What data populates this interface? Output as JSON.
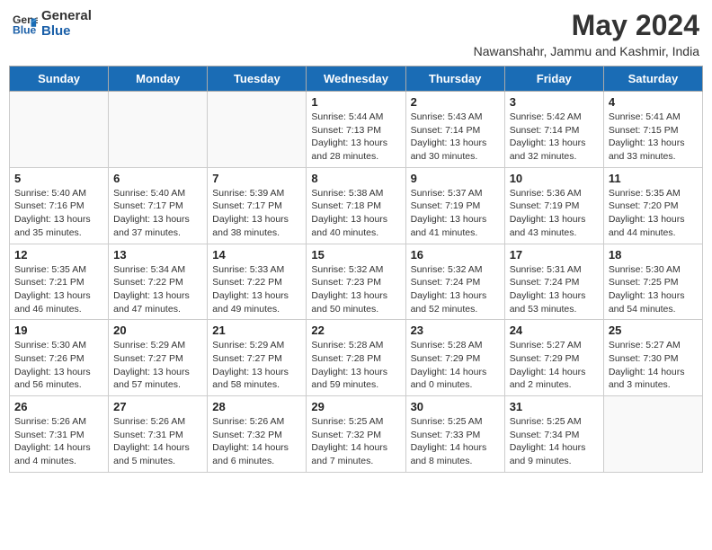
{
  "logo": {
    "general": "General",
    "blue": "Blue"
  },
  "title": "May 2024",
  "subtitle": "Nawanshahr, Jammu and Kashmir, India",
  "days_of_week": [
    "Sunday",
    "Monday",
    "Tuesday",
    "Wednesday",
    "Thursday",
    "Friday",
    "Saturday"
  ],
  "weeks": [
    [
      {
        "day": "",
        "info": ""
      },
      {
        "day": "",
        "info": ""
      },
      {
        "day": "",
        "info": ""
      },
      {
        "day": "1",
        "info": "Sunrise: 5:44 AM\nSunset: 7:13 PM\nDaylight: 13 hours\nand 28 minutes."
      },
      {
        "day": "2",
        "info": "Sunrise: 5:43 AM\nSunset: 7:14 PM\nDaylight: 13 hours\nand 30 minutes."
      },
      {
        "day": "3",
        "info": "Sunrise: 5:42 AM\nSunset: 7:14 PM\nDaylight: 13 hours\nand 32 minutes."
      },
      {
        "day": "4",
        "info": "Sunrise: 5:41 AM\nSunset: 7:15 PM\nDaylight: 13 hours\nand 33 minutes."
      }
    ],
    [
      {
        "day": "5",
        "info": "Sunrise: 5:40 AM\nSunset: 7:16 PM\nDaylight: 13 hours\nand 35 minutes."
      },
      {
        "day": "6",
        "info": "Sunrise: 5:40 AM\nSunset: 7:17 PM\nDaylight: 13 hours\nand 37 minutes."
      },
      {
        "day": "7",
        "info": "Sunrise: 5:39 AM\nSunset: 7:17 PM\nDaylight: 13 hours\nand 38 minutes."
      },
      {
        "day": "8",
        "info": "Sunrise: 5:38 AM\nSunset: 7:18 PM\nDaylight: 13 hours\nand 40 minutes."
      },
      {
        "day": "9",
        "info": "Sunrise: 5:37 AM\nSunset: 7:19 PM\nDaylight: 13 hours\nand 41 minutes."
      },
      {
        "day": "10",
        "info": "Sunrise: 5:36 AM\nSunset: 7:19 PM\nDaylight: 13 hours\nand 43 minutes."
      },
      {
        "day": "11",
        "info": "Sunrise: 5:35 AM\nSunset: 7:20 PM\nDaylight: 13 hours\nand 44 minutes."
      }
    ],
    [
      {
        "day": "12",
        "info": "Sunrise: 5:35 AM\nSunset: 7:21 PM\nDaylight: 13 hours\nand 46 minutes."
      },
      {
        "day": "13",
        "info": "Sunrise: 5:34 AM\nSunset: 7:22 PM\nDaylight: 13 hours\nand 47 minutes."
      },
      {
        "day": "14",
        "info": "Sunrise: 5:33 AM\nSunset: 7:22 PM\nDaylight: 13 hours\nand 49 minutes."
      },
      {
        "day": "15",
        "info": "Sunrise: 5:32 AM\nSunset: 7:23 PM\nDaylight: 13 hours\nand 50 minutes."
      },
      {
        "day": "16",
        "info": "Sunrise: 5:32 AM\nSunset: 7:24 PM\nDaylight: 13 hours\nand 52 minutes."
      },
      {
        "day": "17",
        "info": "Sunrise: 5:31 AM\nSunset: 7:24 PM\nDaylight: 13 hours\nand 53 minutes."
      },
      {
        "day": "18",
        "info": "Sunrise: 5:30 AM\nSunset: 7:25 PM\nDaylight: 13 hours\nand 54 minutes."
      }
    ],
    [
      {
        "day": "19",
        "info": "Sunrise: 5:30 AM\nSunset: 7:26 PM\nDaylight: 13 hours\nand 56 minutes."
      },
      {
        "day": "20",
        "info": "Sunrise: 5:29 AM\nSunset: 7:27 PM\nDaylight: 13 hours\nand 57 minutes."
      },
      {
        "day": "21",
        "info": "Sunrise: 5:29 AM\nSunset: 7:27 PM\nDaylight: 13 hours\nand 58 minutes."
      },
      {
        "day": "22",
        "info": "Sunrise: 5:28 AM\nSunset: 7:28 PM\nDaylight: 13 hours\nand 59 minutes."
      },
      {
        "day": "23",
        "info": "Sunrise: 5:28 AM\nSunset: 7:29 PM\nDaylight: 14 hours\nand 0 minutes."
      },
      {
        "day": "24",
        "info": "Sunrise: 5:27 AM\nSunset: 7:29 PM\nDaylight: 14 hours\nand 2 minutes."
      },
      {
        "day": "25",
        "info": "Sunrise: 5:27 AM\nSunset: 7:30 PM\nDaylight: 14 hours\nand 3 minutes."
      }
    ],
    [
      {
        "day": "26",
        "info": "Sunrise: 5:26 AM\nSunset: 7:31 PM\nDaylight: 14 hours\nand 4 minutes."
      },
      {
        "day": "27",
        "info": "Sunrise: 5:26 AM\nSunset: 7:31 PM\nDaylight: 14 hours\nand 5 minutes."
      },
      {
        "day": "28",
        "info": "Sunrise: 5:26 AM\nSunset: 7:32 PM\nDaylight: 14 hours\nand 6 minutes."
      },
      {
        "day": "29",
        "info": "Sunrise: 5:25 AM\nSunset: 7:32 PM\nDaylight: 14 hours\nand 7 minutes."
      },
      {
        "day": "30",
        "info": "Sunrise: 5:25 AM\nSunset: 7:33 PM\nDaylight: 14 hours\nand 8 minutes."
      },
      {
        "day": "31",
        "info": "Sunrise: 5:25 AM\nSunset: 7:34 PM\nDaylight: 14 hours\nand 9 minutes."
      },
      {
        "day": "",
        "info": ""
      }
    ]
  ]
}
